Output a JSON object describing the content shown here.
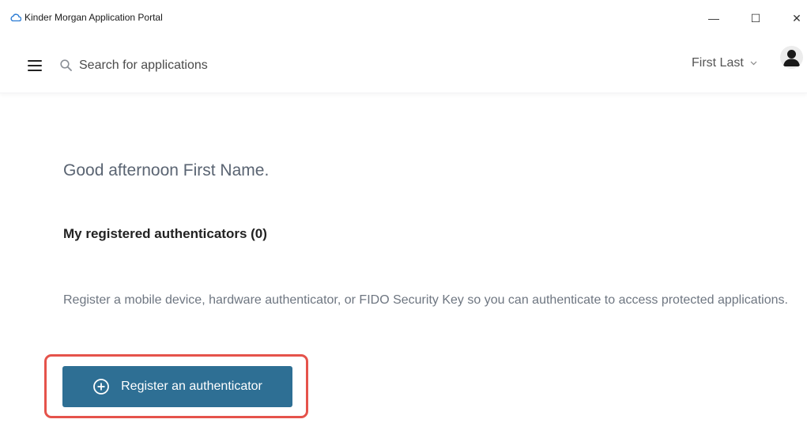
{
  "window": {
    "title": "Kinder Morgan Application Portal",
    "minimize_glyph": "—",
    "maximize_glyph": "☐",
    "close_glyph": "✕"
  },
  "header": {
    "search_placeholder": "Search for applications",
    "user_name": "First Last"
  },
  "main": {
    "greeting": "Good afternoon First Name.",
    "authenticators_heading": "My registered authenticators (0)",
    "description": "Register a mobile device, hardware authenticator, or FIDO Security Key so you can authenticate to access protected applications.",
    "register_button_label": "Register an authenticator"
  },
  "colors": {
    "accent": "#2e6f94",
    "highlight": "#e5534b",
    "app_icon": "#2a7bd4"
  },
  "icons": [
    "cloud-app-icon",
    "hamburger-menu-icon",
    "search-icon",
    "chevron-down-icon",
    "user-avatar-icon",
    "plus-circle-icon"
  ]
}
